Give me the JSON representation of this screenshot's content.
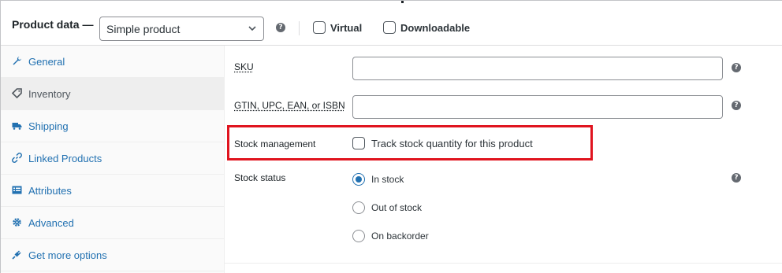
{
  "header": {
    "title": "Product data —",
    "product_type": "Simple product",
    "virtual_label": "Virtual",
    "downloadable_label": "Downloadable",
    "help_glyph": "?"
  },
  "sidebar": {
    "items": [
      {
        "label": "General",
        "icon": "wrench-icon",
        "active": false
      },
      {
        "label": "Inventory",
        "icon": "tag-icon",
        "active": true
      },
      {
        "label": "Shipping",
        "icon": "truck-icon",
        "active": false
      },
      {
        "label": "Linked Products",
        "icon": "link-icon",
        "active": false
      },
      {
        "label": "Attributes",
        "icon": "list-icon",
        "active": false
      },
      {
        "label": "Advanced",
        "icon": "gear-icon",
        "active": false
      },
      {
        "label": "Get more options",
        "icon": "plugin-icon",
        "active": false
      }
    ]
  },
  "form": {
    "sku_label": "SKU",
    "sku_value": "",
    "gtin_label": "GTIN, UPC, EAN, or ISBN",
    "gtin_value": "",
    "stock_management_label": "Stock management",
    "track_stock_label": "Track stock quantity for this product",
    "track_stock_checked": false,
    "stock_status_label": "Stock status",
    "stock_options": [
      "In stock",
      "Out of stock",
      "On backorder"
    ],
    "stock_selected": "In stock"
  },
  "colors": {
    "accent": "#2271b1",
    "highlight": "#e0141f",
    "sidebar_bg": "#fafafa",
    "active_tab_bg": "#eeeeee"
  }
}
